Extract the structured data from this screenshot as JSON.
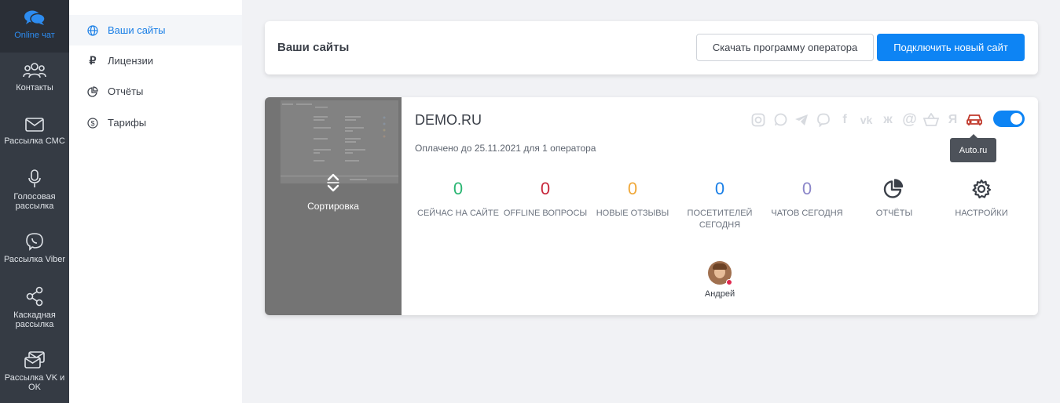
{
  "rail": {
    "items": [
      {
        "label": "Online чат",
        "icon": "chat-bubbles-icon",
        "active": true
      },
      {
        "label": "Контакты",
        "icon": "contacts-icon"
      },
      {
        "label": "Рассылка СМС",
        "icon": "envelope-icon"
      },
      {
        "label": "Голосовая рассылка",
        "icon": "microphone-icon"
      },
      {
        "label": "Рассылка Viber",
        "icon": "viber-icon"
      },
      {
        "label": "Каскадная рассылка",
        "icon": "share-icon"
      },
      {
        "label": "Рассылка VK и OK",
        "icon": "mail-stack-icon"
      }
    ]
  },
  "sidebar": {
    "items": [
      {
        "label": "Ваши сайты",
        "icon": "globe-icon",
        "active": true
      },
      {
        "label": "Лицензии",
        "icon": "ruble-icon",
        "glyph": "₽"
      },
      {
        "label": "Отчёты",
        "icon": "pie-chart-icon"
      },
      {
        "label": "Тарифы",
        "icon": "dollar-circle-icon"
      }
    ]
  },
  "header": {
    "title": "Ваши сайты",
    "download_label": "Скачать программу оператора",
    "connect_label": "Подключить новый сайт"
  },
  "site": {
    "name": "DEMO.RU",
    "paid": "Оплачено до 25.11.2021 для 1 оператора",
    "sort_label": "Сортировка",
    "tooltip": "Auto.ru",
    "enabled": true,
    "socials": [
      {
        "icon": "instagram-icon",
        "glyph": "◎"
      },
      {
        "icon": "whatsapp-icon",
        "glyph": "✆"
      },
      {
        "icon": "telegram-icon",
        "glyph": "➤"
      },
      {
        "icon": "viber-icon",
        "glyph": "✆"
      },
      {
        "icon": "facebook-icon",
        "glyph": "f"
      },
      {
        "icon": "vk-icon",
        "glyph": "vk"
      },
      {
        "icon": "odnoklassniki-icon",
        "glyph": "ж"
      },
      {
        "icon": "email-at-icon",
        "glyph": "@"
      },
      {
        "icon": "basket-icon",
        "glyph": "⌂"
      },
      {
        "icon": "yandex-icon",
        "glyph": "Я"
      },
      {
        "icon": "car-icon",
        "glyph": "⊡",
        "active": true
      }
    ],
    "stats": [
      {
        "value": "0",
        "label": "СЕЙЧАС НА САЙТЕ",
        "color": "#2bb673"
      },
      {
        "value": "0",
        "label": "OFFLINE ВОПРОСЫ",
        "color": "#c8283c"
      },
      {
        "value": "0",
        "label": "НОВЫЕ ОТЗЫВЫ",
        "color": "#f0a93b"
      },
      {
        "value": "0",
        "label": "ПОСЕТИТЕЛЕЙ СЕГОДНЯ",
        "color": "#1a7fe6"
      },
      {
        "value": "0",
        "label": "ЧАТОВ СЕГОДНЯ",
        "color": "#8b86c9"
      }
    ],
    "reports_label": "ОТЧЁТЫ",
    "settings_label": "НАСТРОЙКИ",
    "operator": {
      "name": "Андрей",
      "status": "offline"
    }
  }
}
